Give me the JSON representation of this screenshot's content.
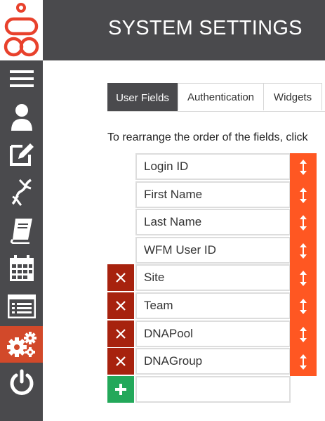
{
  "app": {
    "title": "SYSTEM SETTINGS",
    "logo_icon": "genesys-logo-icon",
    "accent_color": "#d2492a"
  },
  "sidebar": {
    "items": [
      {
        "name": "menu",
        "icon": "hamburger-menu-icon"
      },
      {
        "name": "users",
        "icon": "user-icon"
      },
      {
        "name": "edit",
        "icon": "edit-icon"
      },
      {
        "name": "dna",
        "icon": "dna-icon"
      },
      {
        "name": "knowledge",
        "icon": "book-icon"
      },
      {
        "name": "schedule",
        "icon": "calendar-icon"
      },
      {
        "name": "list",
        "icon": "list-icon"
      },
      {
        "name": "settings",
        "icon": "gears-icon",
        "active": true
      },
      {
        "name": "logout",
        "icon": "power-icon"
      }
    ]
  },
  "tabs": [
    {
      "label": "User Fields",
      "active": true
    },
    {
      "label": "Authentication",
      "active": false
    },
    {
      "label": "Widgets",
      "active": false
    }
  ],
  "instructions": "To rearrange the order of the fields, click",
  "fields": [
    {
      "label": "Login ID",
      "deletable": false
    },
    {
      "label": "First Name",
      "deletable": false
    },
    {
      "label": "Last Name",
      "deletable": false
    },
    {
      "label": "WFM User ID",
      "deletable": false
    },
    {
      "label": "Site",
      "deletable": true
    },
    {
      "label": "Team",
      "deletable": true
    },
    {
      "label": "DNAPool",
      "deletable": true
    },
    {
      "label": "DNAGroup",
      "deletable": true
    }
  ],
  "new_field": {
    "value": "",
    "add_icon": "plus-icon"
  },
  "colors": {
    "sidebar_bg": "#4a4a4d",
    "delete_bg": "#a7220e",
    "handle_bg": "#ff5722",
    "add_bg": "#23a85a"
  }
}
